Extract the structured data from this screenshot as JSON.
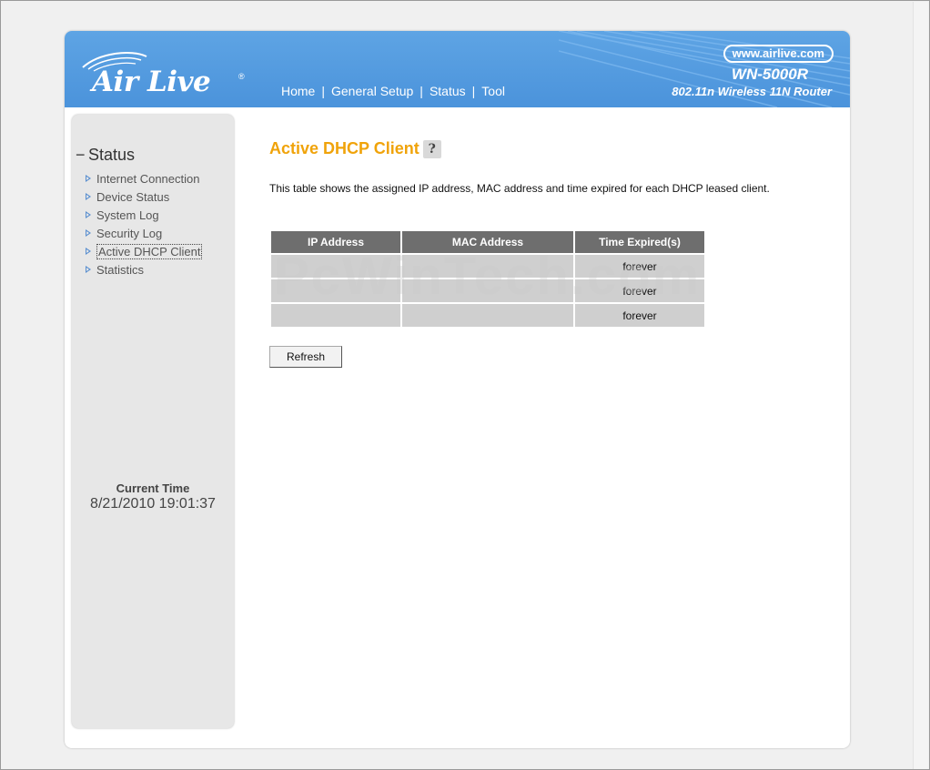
{
  "header": {
    "logo_text": "Air Live",
    "logo_reg": "®",
    "url": "www.airlive.com",
    "model": "WN-5000R",
    "model_sub": "802.11n Wireless 11N Router",
    "nav": [
      {
        "label": "Home"
      },
      {
        "label": "General Setup"
      },
      {
        "label": "Status"
      },
      {
        "label": "Tool"
      }
    ],
    "nav_separator": "|"
  },
  "sidebar": {
    "collapse_glyph": "−",
    "title": "Status",
    "items": [
      {
        "label": "Internet Connection"
      },
      {
        "label": "Device Status"
      },
      {
        "label": "System Log"
      },
      {
        "label": "Security Log"
      },
      {
        "label": "Active DHCP Client",
        "active": true
      },
      {
        "label": "Statistics"
      }
    ],
    "clock_label": "Current Time",
    "clock_value": "8/21/2010 19:01:37"
  },
  "main": {
    "title": "Active DHCP Client",
    "help_glyph": "?",
    "description": "This table shows the assigned IP address, MAC address and time expired for each DHCP leased client.",
    "table": {
      "columns": [
        "IP Address",
        "MAC Address",
        "Time Expired(s)"
      ],
      "rows": [
        [
          "",
          "",
          "forever"
        ],
        [
          "",
          "",
          "forever"
        ],
        [
          "",
          "",
          "forever"
        ]
      ]
    },
    "refresh_label": "Refresh"
  },
  "watermark": "PcWinTech.com",
  "colors": {
    "header_blue": "#4b93db",
    "title_orange": "#f0a30a",
    "table_header": "#6e6e6e",
    "table_cell": "#cfcfcf",
    "sidebar_bg": "#e7e7e7"
  }
}
